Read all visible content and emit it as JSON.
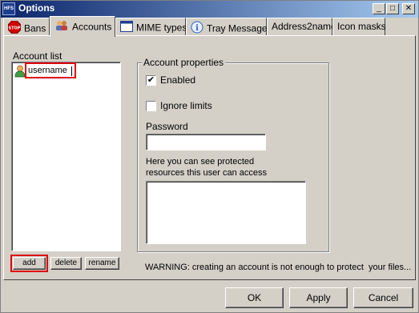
{
  "window": {
    "title": "Options",
    "minimize_glyph": "_",
    "maximize_glyph": "□",
    "close_glyph": "✕"
  },
  "tabs": [
    {
      "label": "Bans",
      "icon": "stop-icon"
    },
    {
      "label": "Accounts",
      "icon": "users-icon",
      "active": true
    },
    {
      "label": "MIME types",
      "icon": "window-icon"
    },
    {
      "label": "Tray Message",
      "icon": "info-icon"
    },
    {
      "label": "Address2name",
      "icon": ""
    },
    {
      "label": "Icon masks",
      "icon": ""
    }
  ],
  "accounts": {
    "list_label": "Account list",
    "items": [
      {
        "name": "username",
        "icon": "user-icon",
        "editing": true
      }
    ],
    "buttons": {
      "add": "add",
      "delete": "delete",
      "rename": "rename"
    }
  },
  "properties": {
    "group_label": "Account properties",
    "enabled_label": "Enabled",
    "enabled_checked": true,
    "ignore_limits_label": "Ignore limits",
    "ignore_limits_checked": false,
    "password_label": "Password",
    "password_value": "",
    "resources_text_line1": "Here you can see protected",
    "resources_text_line2": "resources this user can access"
  },
  "warning": "WARNING: creating an account is not enough to protect  your files...",
  "dialog_buttons": {
    "ok": "OK",
    "apply": "Apply",
    "cancel": "Cancel"
  },
  "colors": {
    "titlebar_start": "#0a246a",
    "titlebar_end": "#a6caf0",
    "face": "#d4d0c8",
    "highlight_box": "#e00000"
  }
}
